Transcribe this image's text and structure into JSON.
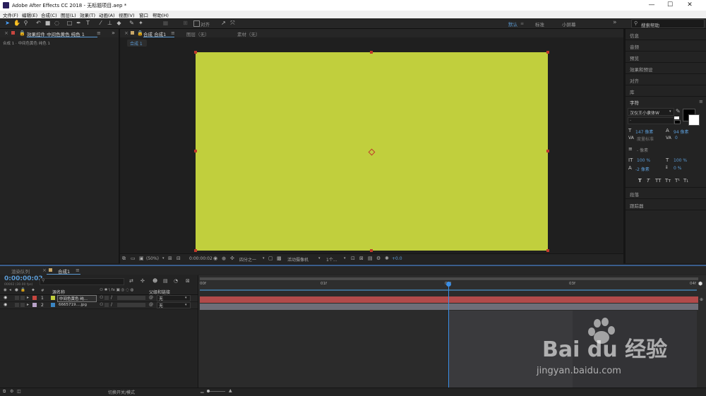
{
  "titlebar": {
    "title": "Adobe After Effects CC 2018 - 无标题项目.aep *",
    "minimize": "—",
    "maximize": "☐",
    "close": "✕"
  },
  "menu": [
    "文件(F)",
    "编辑(E)",
    "合成(C)",
    "图层(L)",
    "效果(T)",
    "动画(A)",
    "视图(V)",
    "窗口",
    "帮助(H)"
  ],
  "toolbar": {
    "align_label": "对齐",
    "workspaces": [
      "默认",
      "标准",
      "小屏幕"
    ],
    "active_workspace": "默认",
    "more": "»",
    "search_placeholder": "搜索帮助"
  },
  "effects_panel": {
    "tab_label": "效果控件 中间色黄色 纯色 1",
    "menu": "≡",
    "expand": "»",
    "breadcrumb": "合成 1 · 中间色黄色 纯色 1"
  },
  "comp_panel": {
    "tab_label": "合成 合成1",
    "menu": "≡",
    "layer_tab": "图层（无）",
    "footage_tab": "素材（无）",
    "subtab": "合成 1",
    "solid_color": "#c1cf3d",
    "zoom": "(50%)",
    "timecode": "0:00:00:02",
    "resolution": "四分之一",
    "camera": "活动摄像机",
    "views": "1个...",
    "exposure": "+0.0"
  },
  "right_panels": {
    "sections": [
      "信息",
      "音频",
      "预览",
      "效果和预设",
      "对齐",
      "库"
    ],
    "character_title": "字符",
    "font_name": "汉仪王小隶体W",
    "font_size": "147 像素",
    "leading": "94 像素",
    "kerning": "度量标准",
    "tracking": "0",
    "stroke": "- 像素",
    "vscale": "100 %",
    "hscale": "100 %",
    "baseline": "-2 像素",
    "tsume": "0 %",
    "text_styles": [
      "T",
      "T",
      "TT",
      "Tт",
      "T¹",
      "T₁"
    ],
    "bottom_sections": [
      "段落",
      "跟踪器"
    ]
  },
  "timeline": {
    "render_queue_tab": "渲染队列",
    "comp_tab": "合成1",
    "menu": "≡",
    "timecode": "0:00:00:02",
    "timecode_sub": "00002 (30.00 fps)",
    "search_placeholder": "",
    "col_num": "#",
    "col_name": "源名称",
    "col_parent": "父级和链接",
    "ruler_labels": [
      "00f",
      "01f",
      "02f",
      "03f",
      "04f"
    ],
    "current_frame": 2,
    "total_frames": 4,
    "work_area_end_frame": 3,
    "layers": [
      {
        "num": "1",
        "name": "中间色黄色 纯...",
        "label_color": "#c8463f",
        "swatch": "#c1cf3d",
        "parent": "无",
        "bar_color": "#b14a4a"
      },
      {
        "num": "2",
        "name": "6665719....jpg",
        "label_color": "#b8a2c8",
        "swatch": "#3b86c4",
        "parent": "无",
        "bar_color": "#6e6e78"
      }
    ],
    "switch_mode": "切换开关/模式"
  },
  "watermark": {
    "logo": "Bai du 经验",
    "url": "jingyan.baidu.com"
  }
}
